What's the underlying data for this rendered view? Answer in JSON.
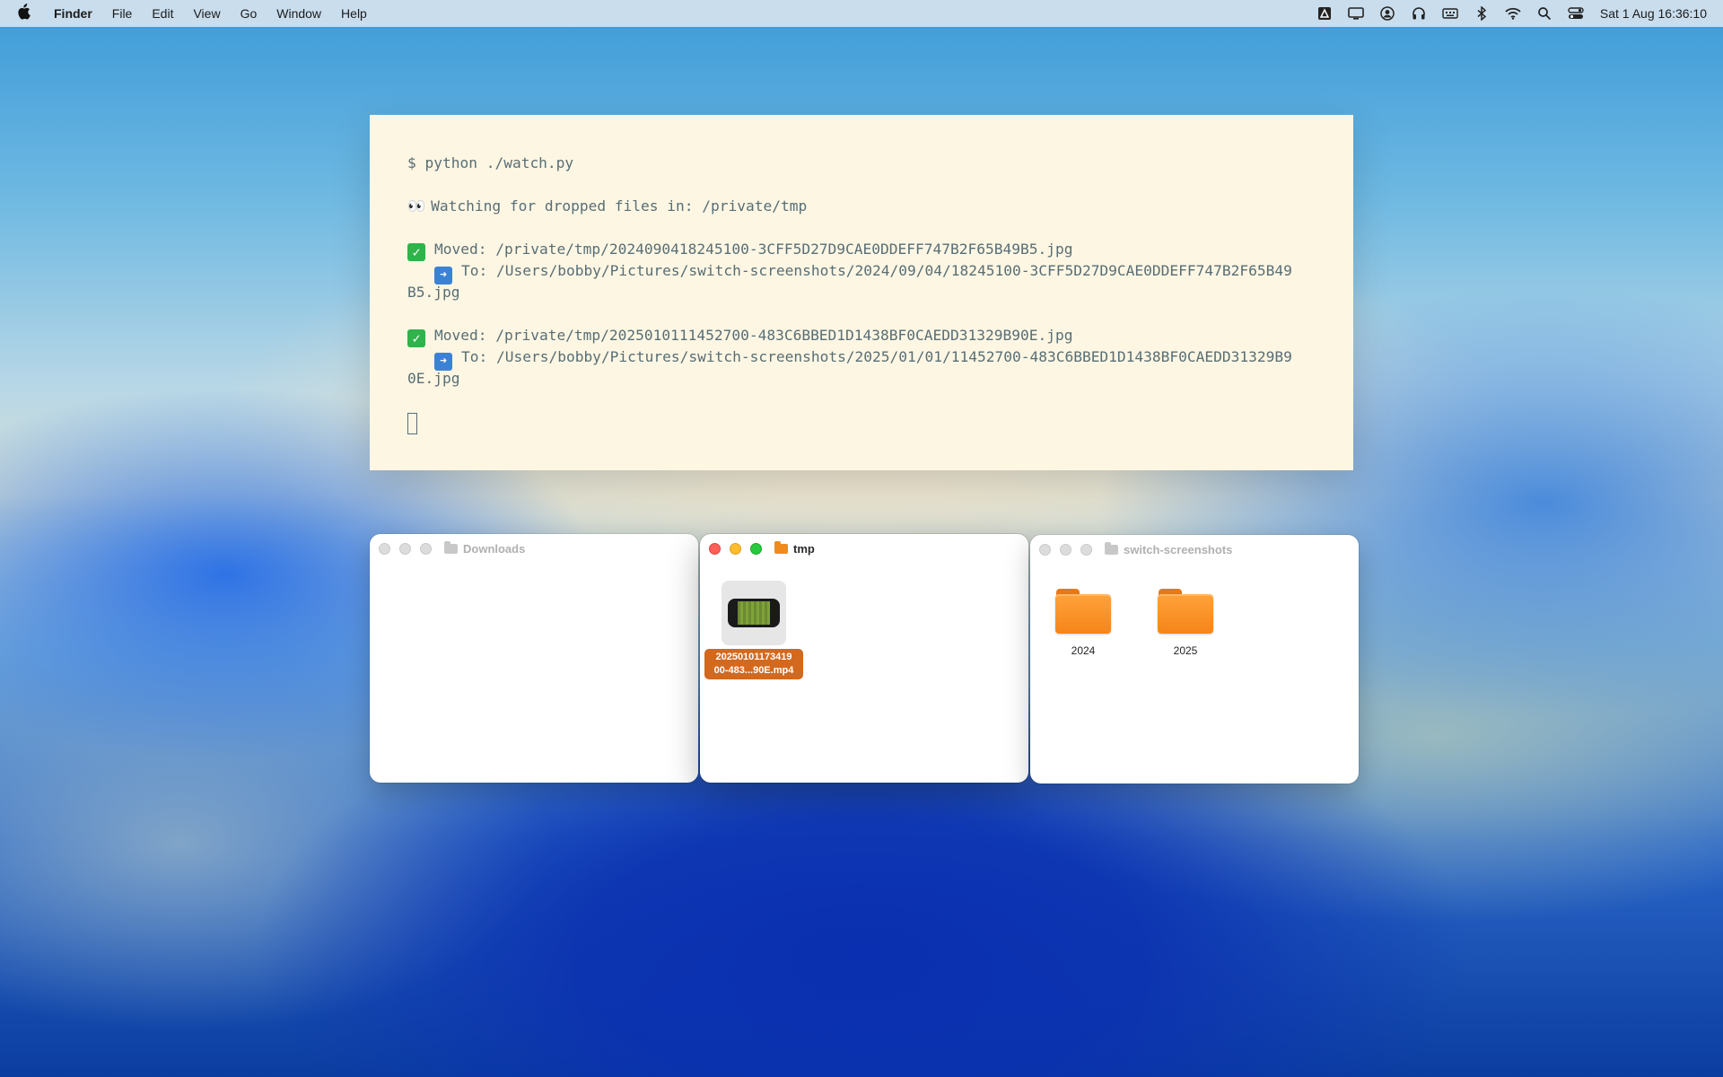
{
  "menubar": {
    "apple": "",
    "app": "Finder",
    "items": [
      "File",
      "Edit",
      "View",
      "Go",
      "Window",
      "Help"
    ],
    "status_icons": [
      "drive-icon",
      "display-icon",
      "user-icon",
      "headphones-icon",
      "keyboard-icon",
      "bluetooth-icon",
      "wifi-icon",
      "search-icon",
      "control-center-icon"
    ],
    "clock": "Sat 1 Aug  16:36:10"
  },
  "terminal": {
    "command": "$ python ./watch.py",
    "watching": "Watching for dropped files in: /private/tmp",
    "entries": [
      {
        "moved": "Moved: /private/tmp/2024090418245100-3CFF5D27D9CAE0DDEFF747B2F65B49B5.jpg",
        "to_line1": "To: /Users/bobby/Pictures/switch-screenshots/2024/09/04/18245100-3CFF5D27D9CAE0DDEFF747B2F65B49",
        "to_line2": "B5.jpg"
      },
      {
        "moved": "Moved: /private/tmp/2025010111452700-483C6BBED1D1438BF0CAEDD31329B90E.jpg",
        "to_line1": "To: /Users/bobby/Pictures/switch-screenshots/2025/01/01/11452700-483C6BBED1D1438BF0CAEDD31329B9",
        "to_line2": "0E.jpg"
      }
    ]
  },
  "windows": {
    "downloads": {
      "title": "Downloads"
    },
    "tmp": {
      "title": "tmp",
      "file": {
        "name_line1": "20250101173419",
        "name_line2": "00-483...90E.mp4"
      }
    },
    "switch": {
      "title": "switch-screenshots",
      "folders": [
        "2024",
        "2025"
      ]
    }
  },
  "colors": {
    "terminal_bg": "#fdf6e3",
    "terminal_text": "#586e75",
    "folder_orange": "#f5851a",
    "selection": "#d2691e"
  }
}
